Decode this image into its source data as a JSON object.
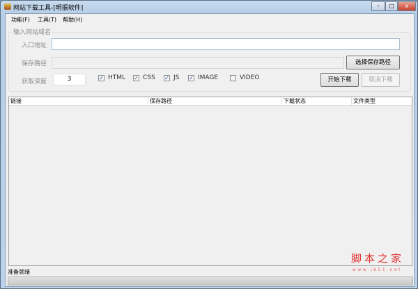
{
  "window": {
    "title": "网站下载工具-[明振软件]",
    "min": "–",
    "max": "□",
    "close": "x"
  },
  "menu": [
    "功能(F)",
    "工具(T)",
    "帮助(H)"
  ],
  "group": {
    "label": "输入网站域名"
  },
  "entry": {
    "label": "入口地址",
    "value": ""
  },
  "save": {
    "label": "保存路径",
    "value": "",
    "button": "选择保存路径"
  },
  "depth": {
    "label": "获取深度",
    "value": "3"
  },
  "checks": [
    {
      "label": "HTML",
      "checked": true
    },
    {
      "label": "CSS",
      "checked": true
    },
    {
      "label": "JS",
      "checked": true
    },
    {
      "label": "IMAGE",
      "checked": true
    },
    {
      "label": "VIDEO",
      "checked": false
    }
  ],
  "buttons": {
    "start": "开始下载",
    "cancel": "取消下载"
  },
  "table": {
    "columns": [
      "链接",
      "保存路径",
      "下载状态",
      "文件类型"
    ]
  },
  "status": {
    "text": "准备就绪",
    "progress": 0
  },
  "watermark": {
    "main": "脚本之家",
    "sub": "www.jb51.net"
  }
}
